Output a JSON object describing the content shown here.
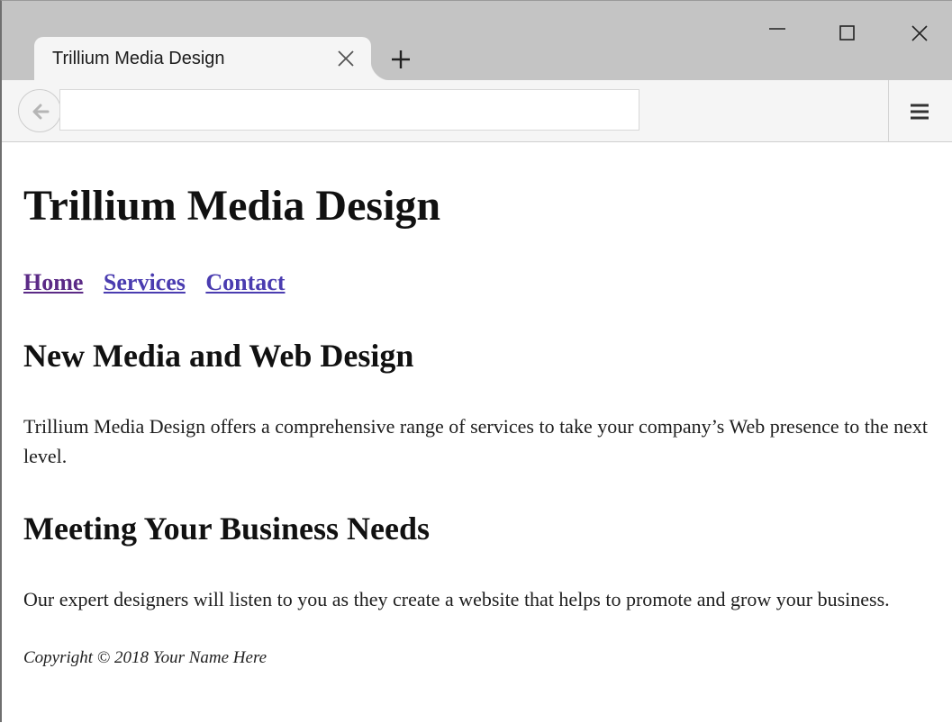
{
  "browser": {
    "tab_title": "Trillium Media Design",
    "address_value": "",
    "icons": {
      "back": "back-arrow-icon",
      "tab_close": "close-icon",
      "new_tab": "plus-icon",
      "minimize": "minimize-icon",
      "maximize": "maximize-icon",
      "close": "close-icon",
      "menu": "hamburger-menu-icon"
    }
  },
  "page": {
    "title": "Trillium Media Design",
    "nav": [
      {
        "label": "Home"
      },
      {
        "label": "Services"
      },
      {
        "label": "Contact"
      }
    ],
    "sections": [
      {
        "heading": "New Media and Web Design",
        "text": "Trillium Media Design offers a comprehensive range of services to take your company’s Web presence to the next level."
      },
      {
        "heading": "Meeting Your Business Needs",
        "text": "Our expert designers will listen to you as they create a website that helps to promote and grow your business."
      }
    ],
    "footer": "Copyright © 2018 Your Name Here"
  },
  "colors": {
    "link": "#4a3cb0",
    "visited_link": "#5b2a86",
    "tabstrip": "#c4c4c4",
    "toolbar": "#f5f5f5"
  }
}
